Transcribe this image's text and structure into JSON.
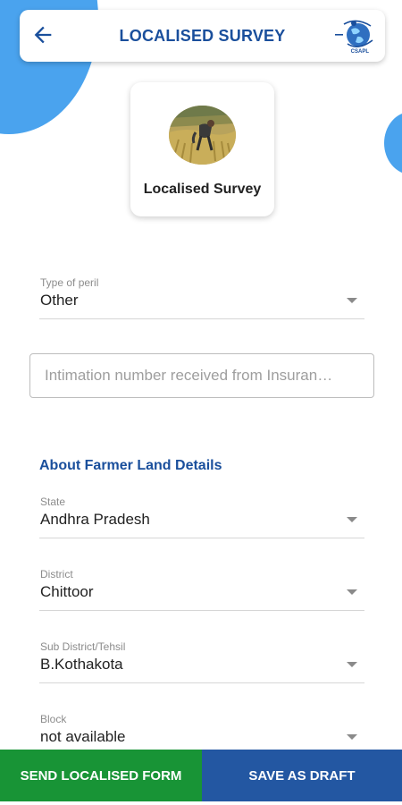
{
  "header": {
    "title": "LOCALISED SURVEY",
    "back_icon": "arrow-left-icon",
    "logo_icon": "globe-logo-icon",
    "logo_text": "CSAPL"
  },
  "survey_card": {
    "label": "Localised Survey",
    "photo": "farmer-field-photo"
  },
  "peril": {
    "label": "Type of peril",
    "value": "Other"
  },
  "intimation": {
    "placeholder": "Intimation number received from Insuran…",
    "value": ""
  },
  "section": {
    "title": "About Farmer Land Details"
  },
  "state": {
    "label": "State",
    "value": "Andhra Pradesh"
  },
  "district": {
    "label": "District",
    "value": "Chittoor"
  },
  "subdistrict": {
    "label": "Sub District/Tehsil",
    "value": "B.Kothakota"
  },
  "block": {
    "label": "Block",
    "value": "not available"
  },
  "actions": {
    "send_label": "SEND LOCALISED FORM",
    "draft_label": "SAVE AS DRAFT"
  },
  "colors": {
    "accent_blue": "#1a4f9c",
    "blob_blue": "#4aa3ee",
    "send_green": "#189436",
    "draft_blue": "#2357a2"
  }
}
